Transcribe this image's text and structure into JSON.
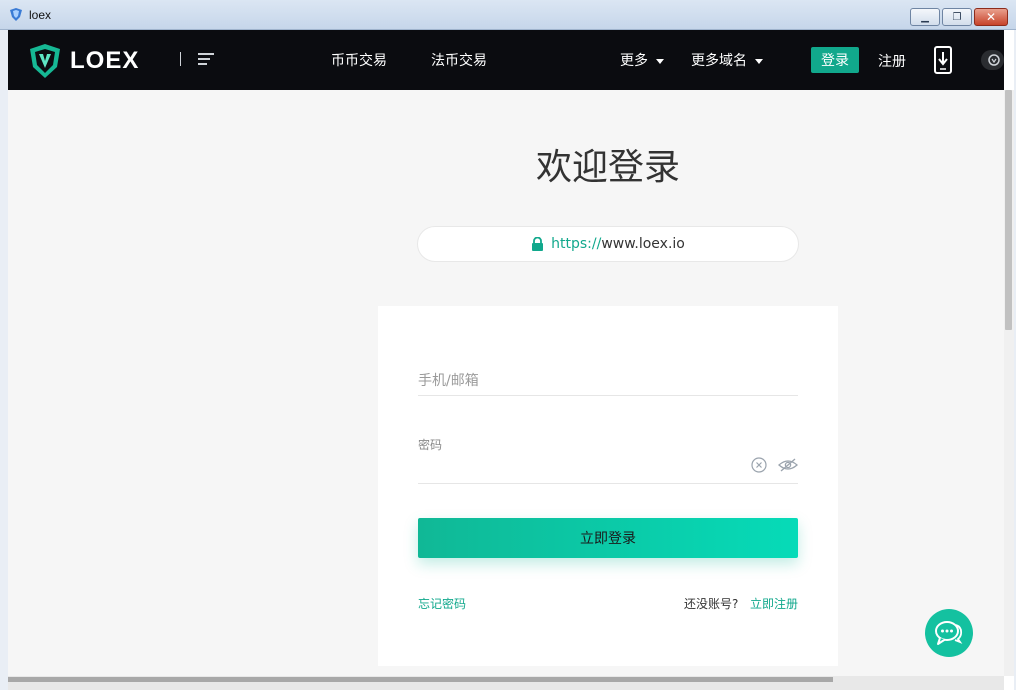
{
  "window": {
    "title": "loex"
  },
  "nav": {
    "logo_text": "LOEX",
    "links": [
      "币币交易",
      "法币交易"
    ],
    "more_label": "更多",
    "domains_label": "更多域名",
    "login_label": "登录",
    "register_label": "注册"
  },
  "main": {
    "welcome_title": "欢迎登录",
    "url_protocol": "https://",
    "url_host": "www.loex.io",
    "phone_placeholder": "手机/邮箱",
    "password_label": "密码",
    "submit_label": "立即登录",
    "forgot_label": "忘记密码",
    "no_account_label": "还没账号?",
    "signup_label": "立即注册"
  },
  "colors": {
    "accent": "#11a88c",
    "navbar": "#0b0c10",
    "background": "#f6f6f6"
  },
  "icons": [
    "shield-logo-icon",
    "menu-icon",
    "lock-icon",
    "clear-icon",
    "eye-off-icon",
    "phone-download-icon",
    "chat-icon"
  ]
}
